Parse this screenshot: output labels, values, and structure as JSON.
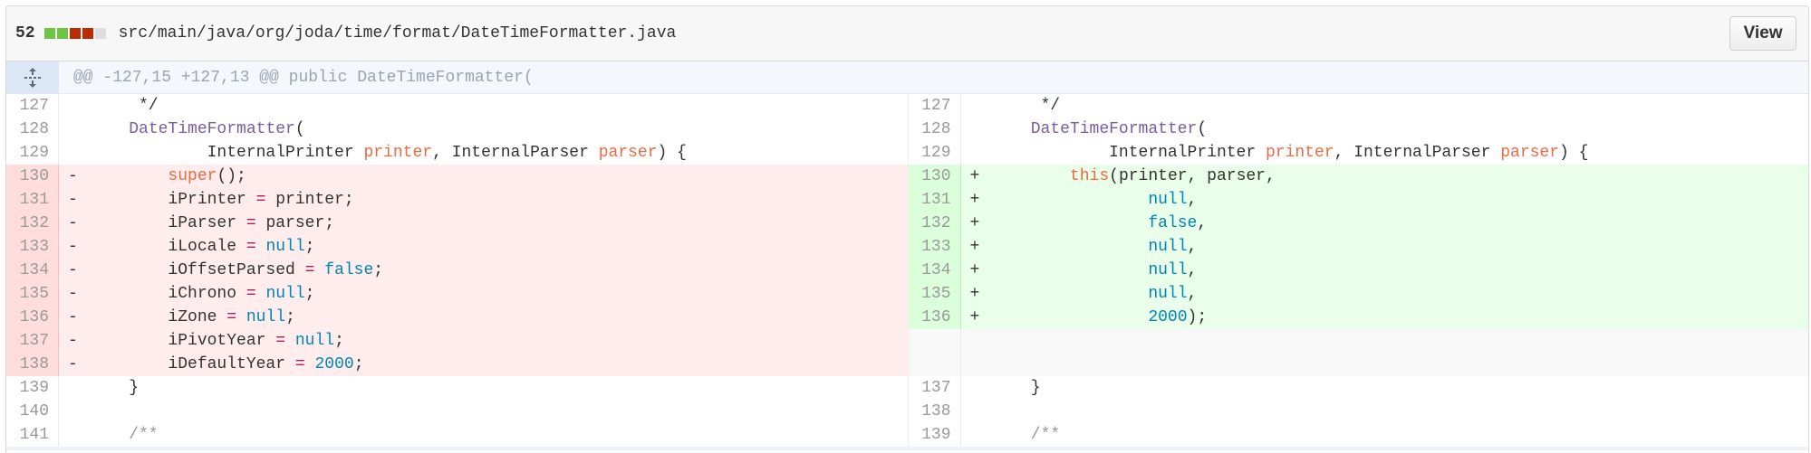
{
  "file": {
    "changes_count": "52",
    "diffstat_colors": [
      "#6cc644",
      "#6cc644",
      "#bd2c00",
      "#bd2c00",
      "#dddddd"
    ],
    "path": "src/main/java/org/joda/time/format/DateTimeFormatter.java",
    "view_label": "View"
  },
  "hunk": {
    "expander_icon": "unfold-icon",
    "header": "@@ -127,15 +127,13 @@ public DateTimeFormatter("
  },
  "colors": {
    "deletion_bg": "#ffecec",
    "deletion_gutter": "#ffdddd",
    "addition_bg": "#eaffea",
    "addition_gutter": "#dbffdb"
  },
  "left": [
    {
      "n": "127",
      "type": "ctx",
      "mark": "",
      "tokens": [
        [
          "plain",
          "     */"
        ]
      ]
    },
    {
      "n": "128",
      "type": "ctx",
      "mark": "",
      "tokens": [
        [
          "plain",
          "    "
        ],
        [
          "purple",
          "DateTimeFormatter"
        ],
        [
          "plain",
          "("
        ]
      ]
    },
    {
      "n": "129",
      "type": "ctx",
      "mark": "",
      "tokens": [
        [
          "plain",
          "            InternalPrinter "
        ],
        [
          "orange",
          "printer"
        ],
        [
          "plain",
          ", InternalParser "
        ],
        [
          "orange",
          "parser"
        ],
        [
          "plain",
          ") {"
        ]
      ]
    },
    {
      "n": "130",
      "type": "del",
      "mark": "-",
      "tokens": [
        [
          "plain",
          "        "
        ],
        [
          "orange",
          "super"
        ],
        [
          "plain",
          "();"
        ]
      ]
    },
    {
      "n": "131",
      "type": "del",
      "mark": "-",
      "tokens": [
        [
          "plain",
          "        iPrinter "
        ],
        [
          "red",
          "="
        ],
        [
          "plain",
          " printer;"
        ]
      ]
    },
    {
      "n": "132",
      "type": "del",
      "mark": "-",
      "tokens": [
        [
          "plain",
          "        iParser "
        ],
        [
          "red",
          "="
        ],
        [
          "plain",
          " parser;"
        ]
      ]
    },
    {
      "n": "133",
      "type": "del",
      "mark": "-",
      "tokens": [
        [
          "plain",
          "        iLocale "
        ],
        [
          "red",
          "="
        ],
        [
          "plain",
          " "
        ],
        [
          "blue",
          "null"
        ],
        [
          "plain",
          ";"
        ]
      ]
    },
    {
      "n": "134",
      "type": "del",
      "mark": "-",
      "tokens": [
        [
          "plain",
          "        iOffsetParsed "
        ],
        [
          "red",
          "="
        ],
        [
          "plain",
          " "
        ],
        [
          "blue",
          "false"
        ],
        [
          "plain",
          ";"
        ]
      ]
    },
    {
      "n": "135",
      "type": "del",
      "mark": "-",
      "tokens": [
        [
          "plain",
          "        iChrono "
        ],
        [
          "red",
          "="
        ],
        [
          "plain",
          " "
        ],
        [
          "blue",
          "null"
        ],
        [
          "plain",
          ";"
        ]
      ]
    },
    {
      "n": "136",
      "type": "del",
      "mark": "-",
      "tokens": [
        [
          "plain",
          "        iZone "
        ],
        [
          "red",
          "="
        ],
        [
          "plain",
          " "
        ],
        [
          "blue",
          "null"
        ],
        [
          "plain",
          ";"
        ]
      ]
    },
    {
      "n": "137",
      "type": "del",
      "mark": "-",
      "tokens": [
        [
          "plain",
          "        iPivotYear "
        ],
        [
          "red",
          "="
        ],
        [
          "plain",
          " "
        ],
        [
          "blue",
          "null"
        ],
        [
          "plain",
          ";"
        ]
      ]
    },
    {
      "n": "138",
      "type": "del",
      "mark": "-",
      "tokens": [
        [
          "plain",
          "        iDefaultYear "
        ],
        [
          "red",
          "="
        ],
        [
          "plain",
          " "
        ],
        [
          "blue",
          "2000"
        ],
        [
          "plain",
          ";"
        ]
      ]
    },
    {
      "n": "139",
      "type": "ctx",
      "mark": "",
      "tokens": [
        [
          "plain",
          "    }"
        ]
      ]
    },
    {
      "n": "140",
      "type": "ctx",
      "mark": "",
      "tokens": [
        [
          "plain",
          ""
        ]
      ]
    },
    {
      "n": "141",
      "type": "ctx",
      "mark": "",
      "tokens": [
        [
          "gray",
          "    /**"
        ]
      ]
    }
  ],
  "right": [
    {
      "n": "127",
      "type": "ctx",
      "mark": "",
      "tokens": [
        [
          "plain",
          "     */"
        ]
      ]
    },
    {
      "n": "128",
      "type": "ctx",
      "mark": "",
      "tokens": [
        [
          "plain",
          "    "
        ],
        [
          "purple",
          "DateTimeFormatter"
        ],
        [
          "plain",
          "("
        ]
      ]
    },
    {
      "n": "129",
      "type": "ctx",
      "mark": "",
      "tokens": [
        [
          "plain",
          "            InternalPrinter "
        ],
        [
          "orange",
          "printer"
        ],
        [
          "plain",
          ", InternalParser "
        ],
        [
          "orange",
          "parser"
        ],
        [
          "plain",
          ") {"
        ]
      ]
    },
    {
      "n": "130",
      "type": "add",
      "mark": "+",
      "tokens": [
        [
          "plain",
          "        "
        ],
        [
          "orange",
          "this"
        ],
        [
          "plain",
          "(printer, parser,"
        ]
      ]
    },
    {
      "n": "131",
      "type": "add",
      "mark": "+",
      "tokens": [
        [
          "plain",
          "                "
        ],
        [
          "blue",
          "null"
        ],
        [
          "plain",
          ","
        ]
      ]
    },
    {
      "n": "132",
      "type": "add",
      "mark": "+",
      "tokens": [
        [
          "plain",
          "                "
        ],
        [
          "blue",
          "false"
        ],
        [
          "plain",
          ","
        ]
      ]
    },
    {
      "n": "133",
      "type": "add",
      "mark": "+",
      "tokens": [
        [
          "plain",
          "                "
        ],
        [
          "blue",
          "null"
        ],
        [
          "plain",
          ","
        ]
      ]
    },
    {
      "n": "134",
      "type": "add",
      "mark": "+",
      "tokens": [
        [
          "plain",
          "                "
        ],
        [
          "blue",
          "null"
        ],
        [
          "plain",
          ","
        ]
      ]
    },
    {
      "n": "135",
      "type": "add",
      "mark": "+",
      "tokens": [
        [
          "plain",
          "                "
        ],
        [
          "blue",
          "null"
        ],
        [
          "plain",
          ","
        ]
      ]
    },
    {
      "n": "136",
      "type": "add",
      "mark": "+",
      "tokens": [
        [
          "plain",
          "                "
        ],
        [
          "blue",
          "2000"
        ],
        [
          "plain",
          ");"
        ]
      ]
    },
    {
      "n": "",
      "type": "empty",
      "mark": "",
      "tokens": []
    },
    {
      "n": "",
      "type": "empty",
      "mark": "",
      "tokens": []
    },
    {
      "n": "137",
      "type": "ctx",
      "mark": "",
      "tokens": [
        [
          "plain",
          "    }"
        ]
      ]
    },
    {
      "n": "138",
      "type": "ctx",
      "mark": "",
      "tokens": [
        [
          "plain",
          ""
        ]
      ]
    },
    {
      "n": "139",
      "type": "ctx",
      "mark": "",
      "tokens": [
        [
          "gray",
          "    /**"
        ]
      ]
    }
  ]
}
